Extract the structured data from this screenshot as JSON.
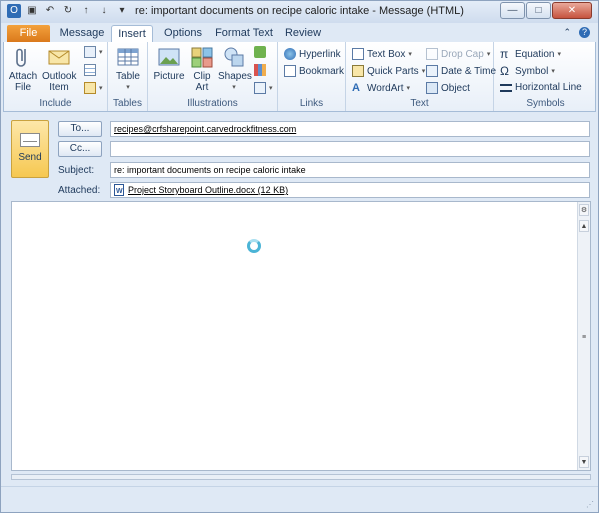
{
  "window": {
    "title": "re: important documents on recipe caloric intake - Message (HTML)",
    "controls": {
      "minimize": "—",
      "maximize": "□",
      "close": "✕"
    }
  },
  "quick_access": [
    "outlook-icon",
    "save-icon",
    "undo-icon",
    "redo-icon",
    "up-icon",
    "down-icon",
    "customize-icon"
  ],
  "tabs": {
    "file": "File",
    "message": "Message",
    "insert": "Insert",
    "options": "Options",
    "format_text": "Format Text",
    "review": "Review",
    "active": "Insert"
  },
  "ribbon": {
    "include": {
      "label": "Include",
      "attach_file": "Attach\nFile",
      "outlook_item": "Outlook\nItem"
    },
    "tables": {
      "label": "Tables",
      "table": "Table"
    },
    "illustrations": {
      "label": "Illustrations",
      "picture": "Picture",
      "clip_art": "Clip\nArt",
      "shapes": "Shapes"
    },
    "links": {
      "label": "Links",
      "hyperlink": "Hyperlink",
      "bookmark": "Bookmark"
    },
    "text": {
      "label": "Text",
      "text_box": "Text Box",
      "quick_parts": "Quick Parts",
      "wordart": "WordArt",
      "drop_cap": "Drop Cap",
      "date_time": "Date & Time",
      "object": "Object"
    },
    "symbols": {
      "label": "Symbols",
      "equation": "Equation",
      "symbol": "Symbol",
      "horizontal_line": "Horizontal Line"
    }
  },
  "compose": {
    "send": "Send",
    "to_button": "To...",
    "cc_button": "Cc...",
    "to_value": "recipes@crfsharepoint.carvedrockfitness.com",
    "cc_value": "",
    "subject_label": "Subject:",
    "subject_value": "re: important documents on recipe caloric intake",
    "attached_label": "Attached:",
    "attachment": "Project Storyboard Outline.docx (12 KB)"
  },
  "colors": {
    "file_tab": "#e58a26",
    "accent": "#1e395b",
    "spinner": "#4bb4d6"
  }
}
